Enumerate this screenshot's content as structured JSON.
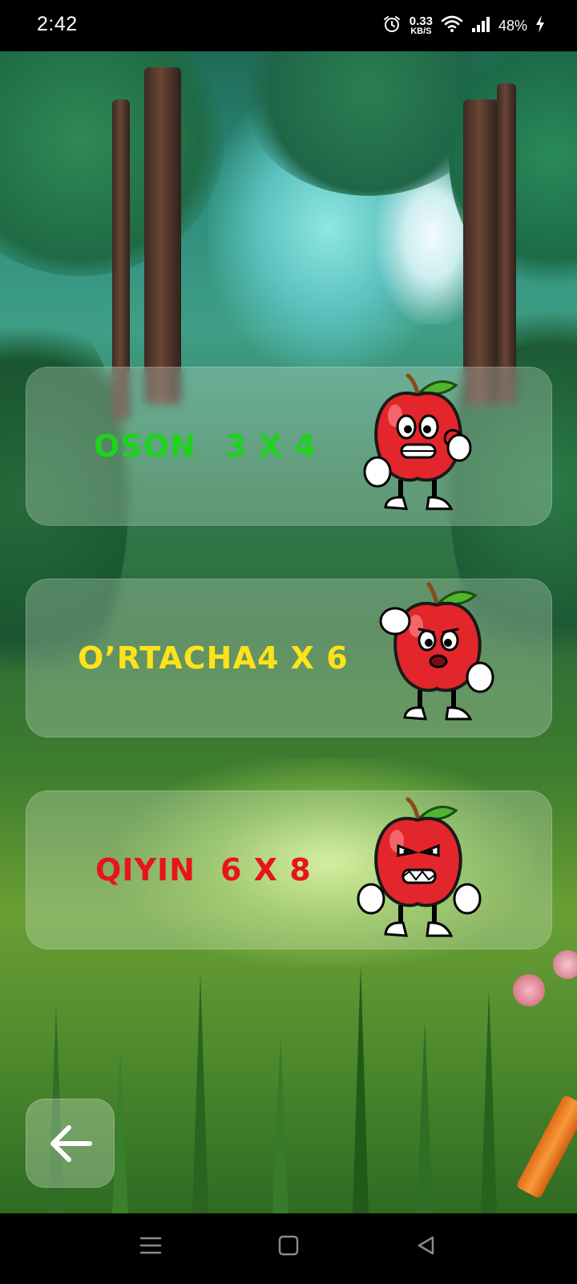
{
  "status_bar": {
    "time": "2:42",
    "net_speed_value": "0.33",
    "net_speed_unit": "KB/S",
    "battery_percent": "48%",
    "icons": [
      "alarm-icon",
      "wifi-icon",
      "signal-icon",
      "charging-icon"
    ]
  },
  "levels": [
    {
      "name": "OSON",
      "grid": "3 X 4",
      "color": "#1ed31e",
      "mood": "happy-ok"
    },
    {
      "name": "O’RTACHA",
      "grid": "4 X 6",
      "color": "#ffe21a",
      "mood": "thinking"
    },
    {
      "name": "QIYIN",
      "grid": "6 X 8",
      "color": "#e8141b",
      "mood": "angry"
    }
  ],
  "back_button": {
    "icon": "arrow-left-icon"
  },
  "nav_bar": {
    "icons": [
      "menu-icon",
      "home-icon",
      "back-triangle-icon"
    ]
  }
}
